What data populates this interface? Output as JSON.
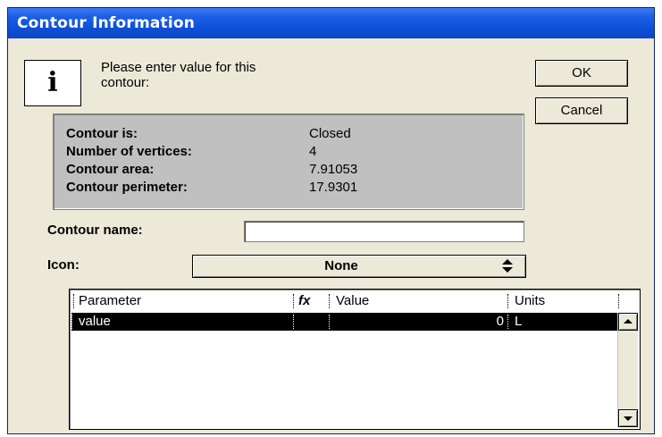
{
  "window": {
    "title": "Contour Information"
  },
  "info_icon": {
    "glyph": "i"
  },
  "prompt": {
    "line1": "Please enter value for this",
    "line2": "contour:"
  },
  "buttons": {
    "ok": "OK",
    "cancel": "Cancel"
  },
  "contour_info": {
    "rows": [
      {
        "label": "Contour is:",
        "value": "Closed"
      },
      {
        "label": "Number of vertices:",
        "value": "4"
      },
      {
        "label": "Contour area:",
        "value": "7.91053"
      },
      {
        "label": "Contour perimeter:",
        "value": "17.9301"
      }
    ]
  },
  "contour_name": {
    "label": "Contour name:",
    "value": ""
  },
  "icon_select": {
    "label": "Icon:",
    "value": "None"
  },
  "table": {
    "headers": {
      "parameter": "Parameter",
      "fx": "fx",
      "value": "Value",
      "units": "Units"
    },
    "rows": [
      {
        "parameter": "value",
        "fx": "",
        "value": "0",
        "units": "L",
        "selected": true
      }
    ]
  },
  "colors": {
    "titlebar": "#0b46c4",
    "dialog_bg": "#ece9d8",
    "panel_bg": "#c0c0c0",
    "selected_row_bg": "#000000"
  }
}
